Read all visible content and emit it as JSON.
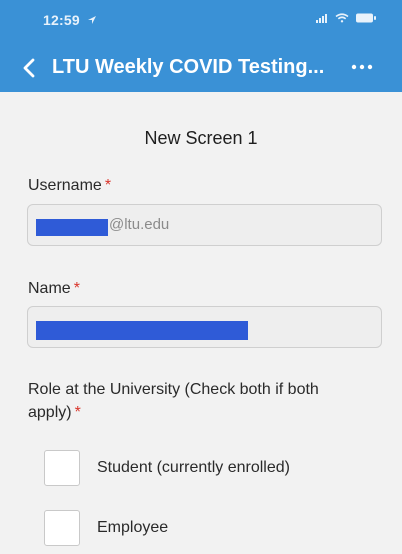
{
  "status_bar": {
    "time": "12:59",
    "icons": [
      "location-arrow-icon",
      "cellular-signal-icon",
      "wifi-icon",
      "battery-icon"
    ]
  },
  "header": {
    "title": "LTU Weekly COVID Testing...",
    "back_icon": "chevron-left-icon",
    "more_icon": "more-dots-icon",
    "color": "#3a91d6"
  },
  "form": {
    "screen_title": "New Screen 1",
    "username": {
      "label": "Username",
      "required_mark": "*",
      "value_suffix": "@ltu.edu"
    },
    "name": {
      "label": "Name",
      "required_mark": "*"
    },
    "role": {
      "label": "Role at the University (Check both if both apply)",
      "required_mark": "*",
      "options": [
        {
          "label": "Student (currently enrolled)",
          "checked": false
        },
        {
          "label": "Employee",
          "checked": false
        }
      ]
    }
  },
  "colors": {
    "required": "#d9352b",
    "redaction": "#2f5bd7"
  }
}
